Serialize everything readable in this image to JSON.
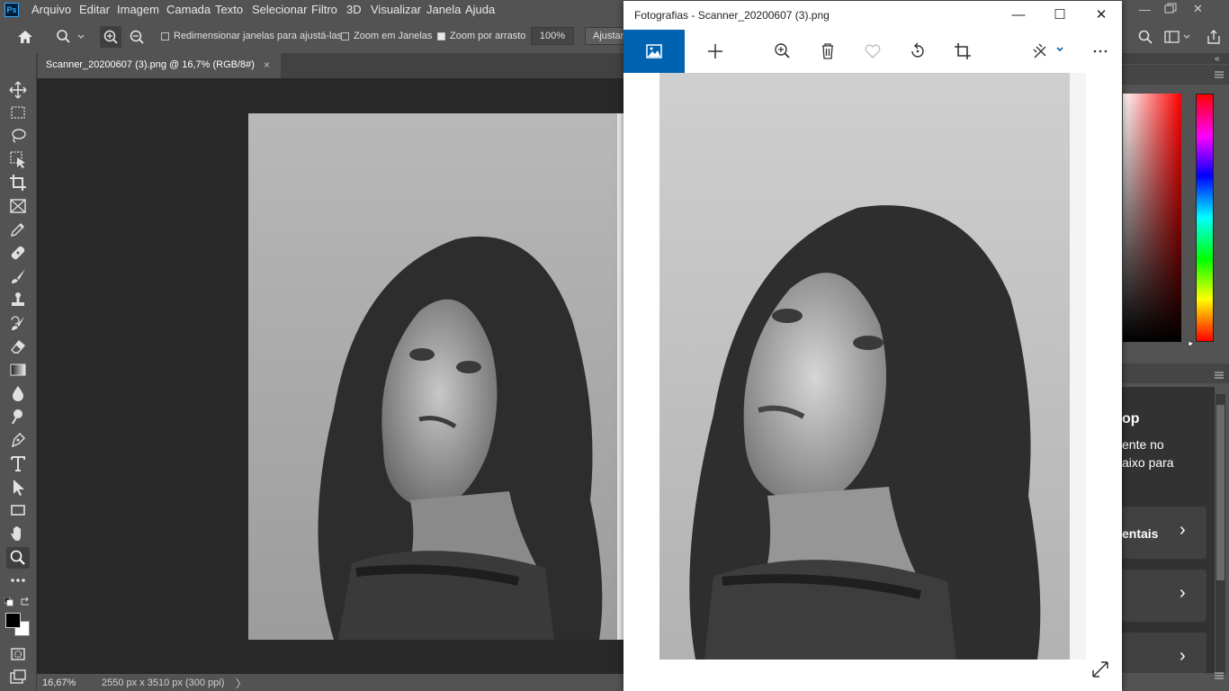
{
  "ps": {
    "logo": "Ps",
    "menu": [
      "Arquivo",
      "Editar",
      "Imagem",
      "Camada",
      "Texto",
      "Selecionar",
      "Filtro",
      "3D",
      "Visualizar",
      "Janela",
      "Ajuda"
    ],
    "options": {
      "resize_windows": "Redimensionar janelas para ajustá-las",
      "zoom_all_windows": "Zoom em Janelas",
      "scrubby_zoom": "Zoom por arrasto",
      "zoom_value": "100%",
      "fit_button": "Ajustar"
    },
    "doc_tab": {
      "label": "Scanner_20200607 (3).png @ 16,7% (RGB/8#)",
      "close": "×"
    },
    "status": {
      "zoom": "16,67%",
      "doc_size": "2550 px x 3510 px (300 ppi)",
      "arrow": "〉"
    },
    "tools": [
      "move-tool",
      "marquee-tool",
      "lasso-tool",
      "object-select-tool",
      "crop-tool",
      "frame-tool",
      "eyedropper-tool",
      "healing-brush-tool",
      "brush-tool",
      "clone-stamp-tool",
      "history-brush-tool",
      "eraser-tool",
      "gradient-tool",
      "blur-tool",
      "dodge-tool",
      "pen-tool",
      "type-tool",
      "path-select-tool",
      "rectangle-tool",
      "hand-tool",
      "zoom-tool",
      "more-tools"
    ],
    "learn_panel": {
      "line1": "op",
      "line2": "ente no",
      "line3": "aixo para",
      "card1": "entais",
      "chevron": "›"
    }
  },
  "photos": {
    "title": "Fotografias - Scanner_20200607 (3).png",
    "window_controls": {
      "minimize": "—",
      "maximize": "☐",
      "close": "✕"
    },
    "toolbar_icons": [
      "view-icon",
      "add-icon",
      "zoom-in-icon",
      "delete-icon",
      "favorite-icon",
      "rotate-icon",
      "crop-icon",
      "edit-icon",
      "more-icon"
    ],
    "expand_icon": "expand-icon"
  },
  "colors": {
    "ps_bg": "#535353",
    "canvas_bg": "#282828",
    "photos_accent": "#0063b1"
  }
}
